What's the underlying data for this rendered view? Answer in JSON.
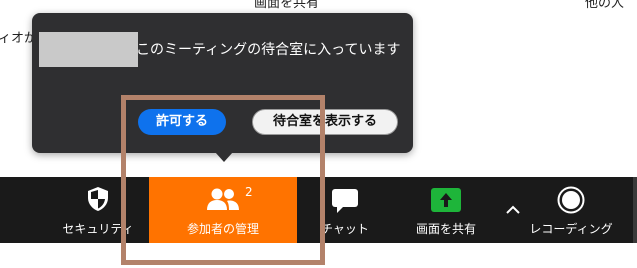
{
  "background": {
    "top_label_1": "画面を共有",
    "top_label_2": "他の人",
    "left_label": "ィオが"
  },
  "popup": {
    "message": "このミーティングの待合室に入っています",
    "admit_label": "許可する",
    "view_waiting_room_label": "待合室を表示する"
  },
  "toolbar": {
    "security_label": "セキュリティ",
    "participants_label": "参加者の管理",
    "participants_count": "2",
    "chat_label": "チャット",
    "share_label": "画面を共有",
    "record_label": "レコーディング"
  },
  "colors": {
    "toolbar_bg": "#1a1a1a",
    "participants_active": "#ff7300",
    "share_green": "#1eb53a",
    "admit_blue": "#0e72ed",
    "highlight_frame": "#b3826a",
    "popup_bg": "#2f2f31"
  },
  "icons": {
    "security": "shield-icon",
    "participants": "people-icon",
    "chat": "chat-bubble-icon",
    "share": "share-arrow-up-icon",
    "caret": "chevron-up-icon",
    "record": "record-circle-icon"
  }
}
